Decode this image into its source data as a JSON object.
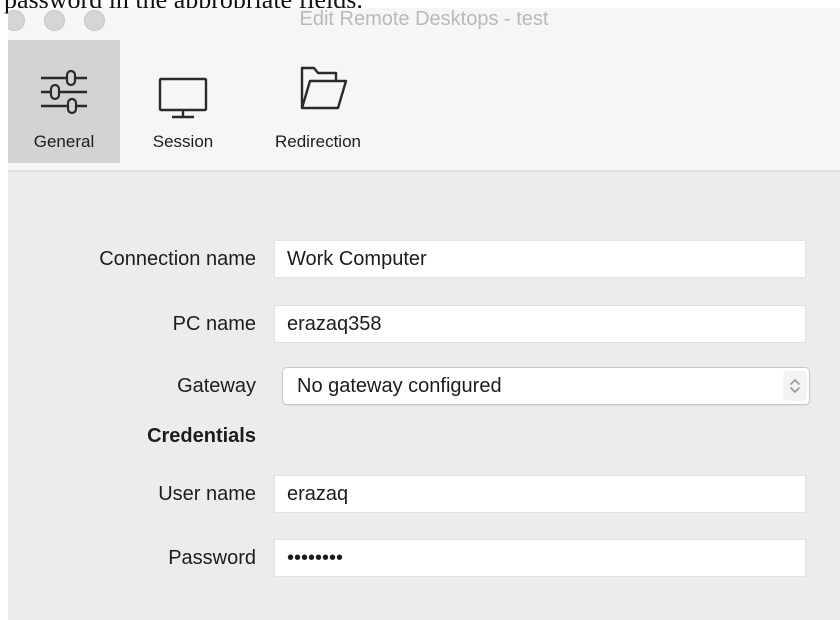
{
  "background_text": "password in the appropriate fields.",
  "window": {
    "title": "Edit Remote Desktops - test"
  },
  "toolbar": {
    "items": [
      {
        "label": "General",
        "icon": "sliders-icon",
        "selected": true
      },
      {
        "label": "Session",
        "icon": "monitor-icon",
        "selected": false
      },
      {
        "label": "Redirection",
        "icon": "folder-icon",
        "selected": false
      }
    ]
  },
  "form": {
    "connection_name": {
      "label": "Connection name",
      "value": "Work Computer"
    },
    "pc_name": {
      "label": "PC name",
      "value": "erazaq358"
    },
    "gateway": {
      "label": "Gateway",
      "value": "No gateway configured"
    },
    "credentials_heading": "Credentials",
    "user_name": {
      "label": "User name",
      "value": "erazaq"
    },
    "password": {
      "label": "Password",
      "value": "••••••••"
    }
  },
  "colors": {
    "window_bg": "#ececec",
    "toolbar_bg": "#f6f6f6",
    "selected_tab_bg": "#d3d3d3",
    "field_bg": "#ffffff"
  }
}
